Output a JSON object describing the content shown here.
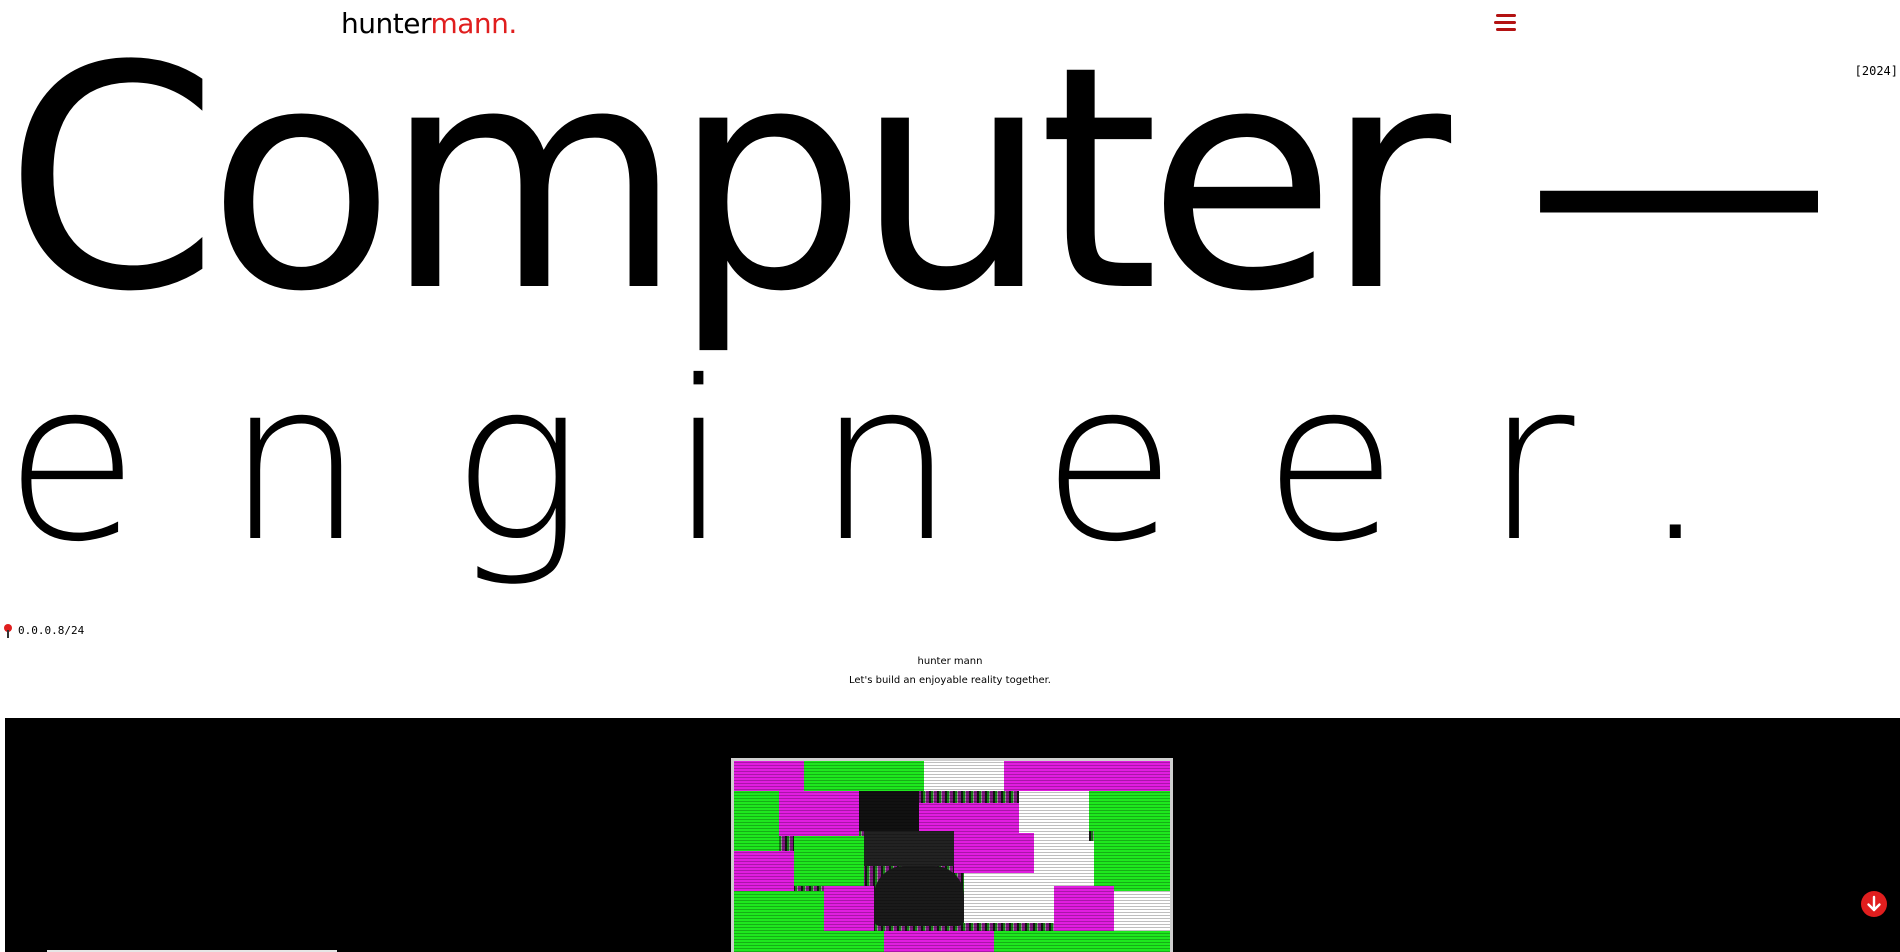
{
  "header": {
    "logo_part_1": "hunter",
    "logo_part_2": "mann",
    "logo_part_3": ".",
    "menu_icon": "hamburger-menu-icon"
  },
  "year_badge": "[2024]",
  "hero": {
    "line_1": "Computer —",
    "line_2": "engineer."
  },
  "ip_readout": {
    "icon": "location-pin-icon",
    "value": "0.0.0.8/24"
  },
  "tagline": {
    "name": "hunter mann",
    "subtitle": "Let's build an enjoyable reality together."
  },
  "showcase": {
    "image_alt": "glitch-portrait"
  },
  "scroll_button": {
    "icon": "arrow-down-icon"
  },
  "colors": {
    "accent": "#e01e1e",
    "menu": "#b31212",
    "glitch_magenta": "#e11de0",
    "glitch_green": "#1ee81e",
    "showcase_background": "#000000"
  }
}
